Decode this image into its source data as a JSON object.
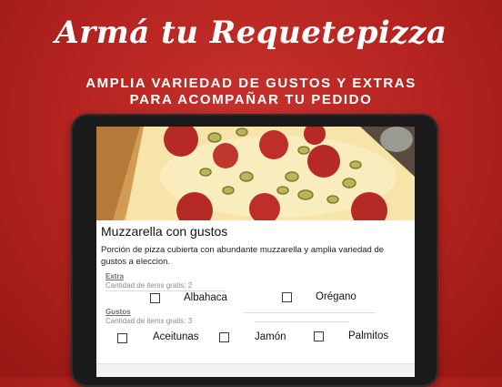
{
  "promo": {
    "headline": "Armá tu Requetepizza",
    "subline_1": "AMPLIA VARIEDAD DE GUSTOS Y EXTRAS",
    "subline_2": "PARA ACOMPAÑAR TU PEDIDO"
  },
  "product": {
    "title": "Muzzarella con gustos",
    "description": "Porción de pizza cubierta con abundante muzzarella   y amplia variedad de gustos a eleccion."
  },
  "sections": [
    {
      "label": "Extra",
      "hint": "Cantidad de items gratis: 2",
      "options": [
        "Albahaca",
        "Orégano"
      ]
    },
    {
      "label": "Gustos",
      "hint": "Cantidad de items gratis: 3",
      "options": [
        "Aceitunas",
        "Jamón",
        "Palmitos"
      ]
    }
  ],
  "colors": {
    "background_red": "#b3231f",
    "tablet_bezel": "#1a1a1a",
    "text_white": "#ffffff"
  },
  "icons": {
    "hero": "pizza-photo"
  }
}
